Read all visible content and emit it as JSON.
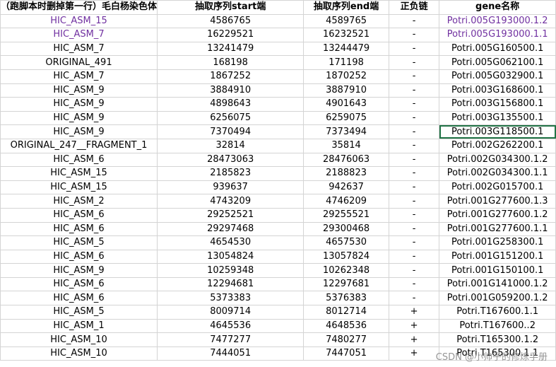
{
  "sheet": {
    "headers": [
      "（跑脚本时删掉第一行）毛白杨染色体",
      "抽取序列start端",
      "抽取序列end端",
      "正负链",
      "gene名称"
    ],
    "rows": [
      {
        "chrom": "HIC_ASM_15",
        "start": "4586765",
        "end": "4589765",
        "strand": "-",
        "gene": "Potri.005G193000.1.2",
        "color": "#7030a0"
      },
      {
        "chrom": "HIC_ASM_7",
        "start": "16229521",
        "end": "16232521",
        "strand": "-",
        "gene": "Potri.005G193000.1.1",
        "color": "#7030a0"
      },
      {
        "chrom": "HIC_ASM_7",
        "start": "13241479",
        "end": "13244479",
        "strand": "-",
        "gene": "Potri.005G160500.1",
        "color": "#000000"
      },
      {
        "chrom": "ORIGINAL_491",
        "start": "168198",
        "end": "171198",
        "strand": "-",
        "gene": "Potri.005G062100.1",
        "color": "#000000"
      },
      {
        "chrom": "HIC_ASM_7",
        "start": "1867252",
        "end": "1870252",
        "strand": "-",
        "gene": "Potri.005G032900.1",
        "color": "#000000"
      },
      {
        "chrom": "HIC_ASM_9",
        "start": "3884910",
        "end": "3887910",
        "strand": "-",
        "gene": "Potri.003G168600.1",
        "color": "#000000"
      },
      {
        "chrom": "HIC_ASM_9",
        "start": "4898643",
        "end": "4901643",
        "strand": "-",
        "gene": "Potri.003G156800.1",
        "color": "#000000"
      },
      {
        "chrom": "HIC_ASM_9",
        "start": "6256075",
        "end": "6259075",
        "strand": "-",
        "gene": "Potri.003G135500.1",
        "color": "#000000"
      },
      {
        "chrom": "HIC_ASM_9",
        "start": "7370494",
        "end": "7373494",
        "strand": "-",
        "gene": "Potri.003G118500.1",
        "color": "#000000"
      },
      {
        "chrom": "ORIGINAL_247__FRAGMENT_1",
        "start": "32814",
        "end": "35814",
        "strand": "-",
        "gene": "Potri.002G262200.1",
        "color": "#000000"
      },
      {
        "chrom": "HIC_ASM_6",
        "start": "28473063",
        "end": "28476063",
        "strand": "-",
        "gene": "Potri.002G034300.1.2",
        "color": "#000000"
      },
      {
        "chrom": "HIC_ASM_15",
        "start": "2185823",
        "end": "2188823",
        "strand": "-",
        "gene": "Potri.002G034300.1.1",
        "color": "#000000"
      },
      {
        "chrom": "HIC_ASM_15",
        "start": "939637",
        "end": "942637",
        "strand": "-",
        "gene": "Potri.002G015700.1",
        "color": "#000000"
      },
      {
        "chrom": "HIC_ASM_2",
        "start": "4743209",
        "end": "4746209",
        "strand": "-",
        "gene": "Potri.001G277600.1.3",
        "color": "#000000"
      },
      {
        "chrom": "HIC_ASM_6",
        "start": "29252521",
        "end": "29255521",
        "strand": "-",
        "gene": "Potri.001G277600.1.2",
        "color": "#000000"
      },
      {
        "chrom": "HIC_ASM_6",
        "start": "29297468",
        "end": "29300468",
        "strand": "-",
        "gene": "Potri.001G277600.1.1",
        "color": "#000000"
      },
      {
        "chrom": "HIC_ASM_5",
        "start": "4654530",
        "end": "4657530",
        "strand": "-",
        "gene": "Potri.001G258300.1",
        "color": "#000000"
      },
      {
        "chrom": "HIC_ASM_6",
        "start": "13054824",
        "end": "13057824",
        "strand": "-",
        "gene": "Potri.001G151200.1",
        "color": "#000000"
      },
      {
        "chrom": "HIC_ASM_9",
        "start": "10259348",
        "end": "10262348",
        "strand": "-",
        "gene": "Potri.001G150100.1",
        "color": "#000000"
      },
      {
        "chrom": "HIC_ASM_6",
        "start": "12294681",
        "end": "12297681",
        "strand": "-",
        "gene": "Potri.001G141000.1.2",
        "color": "#000000"
      },
      {
        "chrom": "HIC_ASM_6",
        "start": "5373383",
        "end": "5376383",
        "strand": "-",
        "gene": "Potri.001G059200.1.2",
        "color": "#000000"
      },
      {
        "chrom": "HIC_ASM_5",
        "start": "8009714",
        "end": "8012714",
        "strand": "+",
        "gene": "Potri.T167600.1.1",
        "color": "#000000"
      },
      {
        "chrom": "HIC_ASM_1",
        "start": "4645536",
        "end": "4648536",
        "strand": "+",
        "gene": "Potri.T167600..2",
        "color": "#000000"
      },
      {
        "chrom": "HIC_ASM_10",
        "start": "7477277",
        "end": "7480277",
        "strand": "+",
        "gene": "Potri.T165300.1.2",
        "color": "#000000"
      },
      {
        "chrom": "HIC_ASM_10",
        "start": "7444051",
        "end": "7447051",
        "strand": "+",
        "gene": "Potri.T165300.1.1",
        "color": "#000000"
      }
    ],
    "active_row": 8
  },
  "watermark": "CSDN @小帅子的修炼手册"
}
